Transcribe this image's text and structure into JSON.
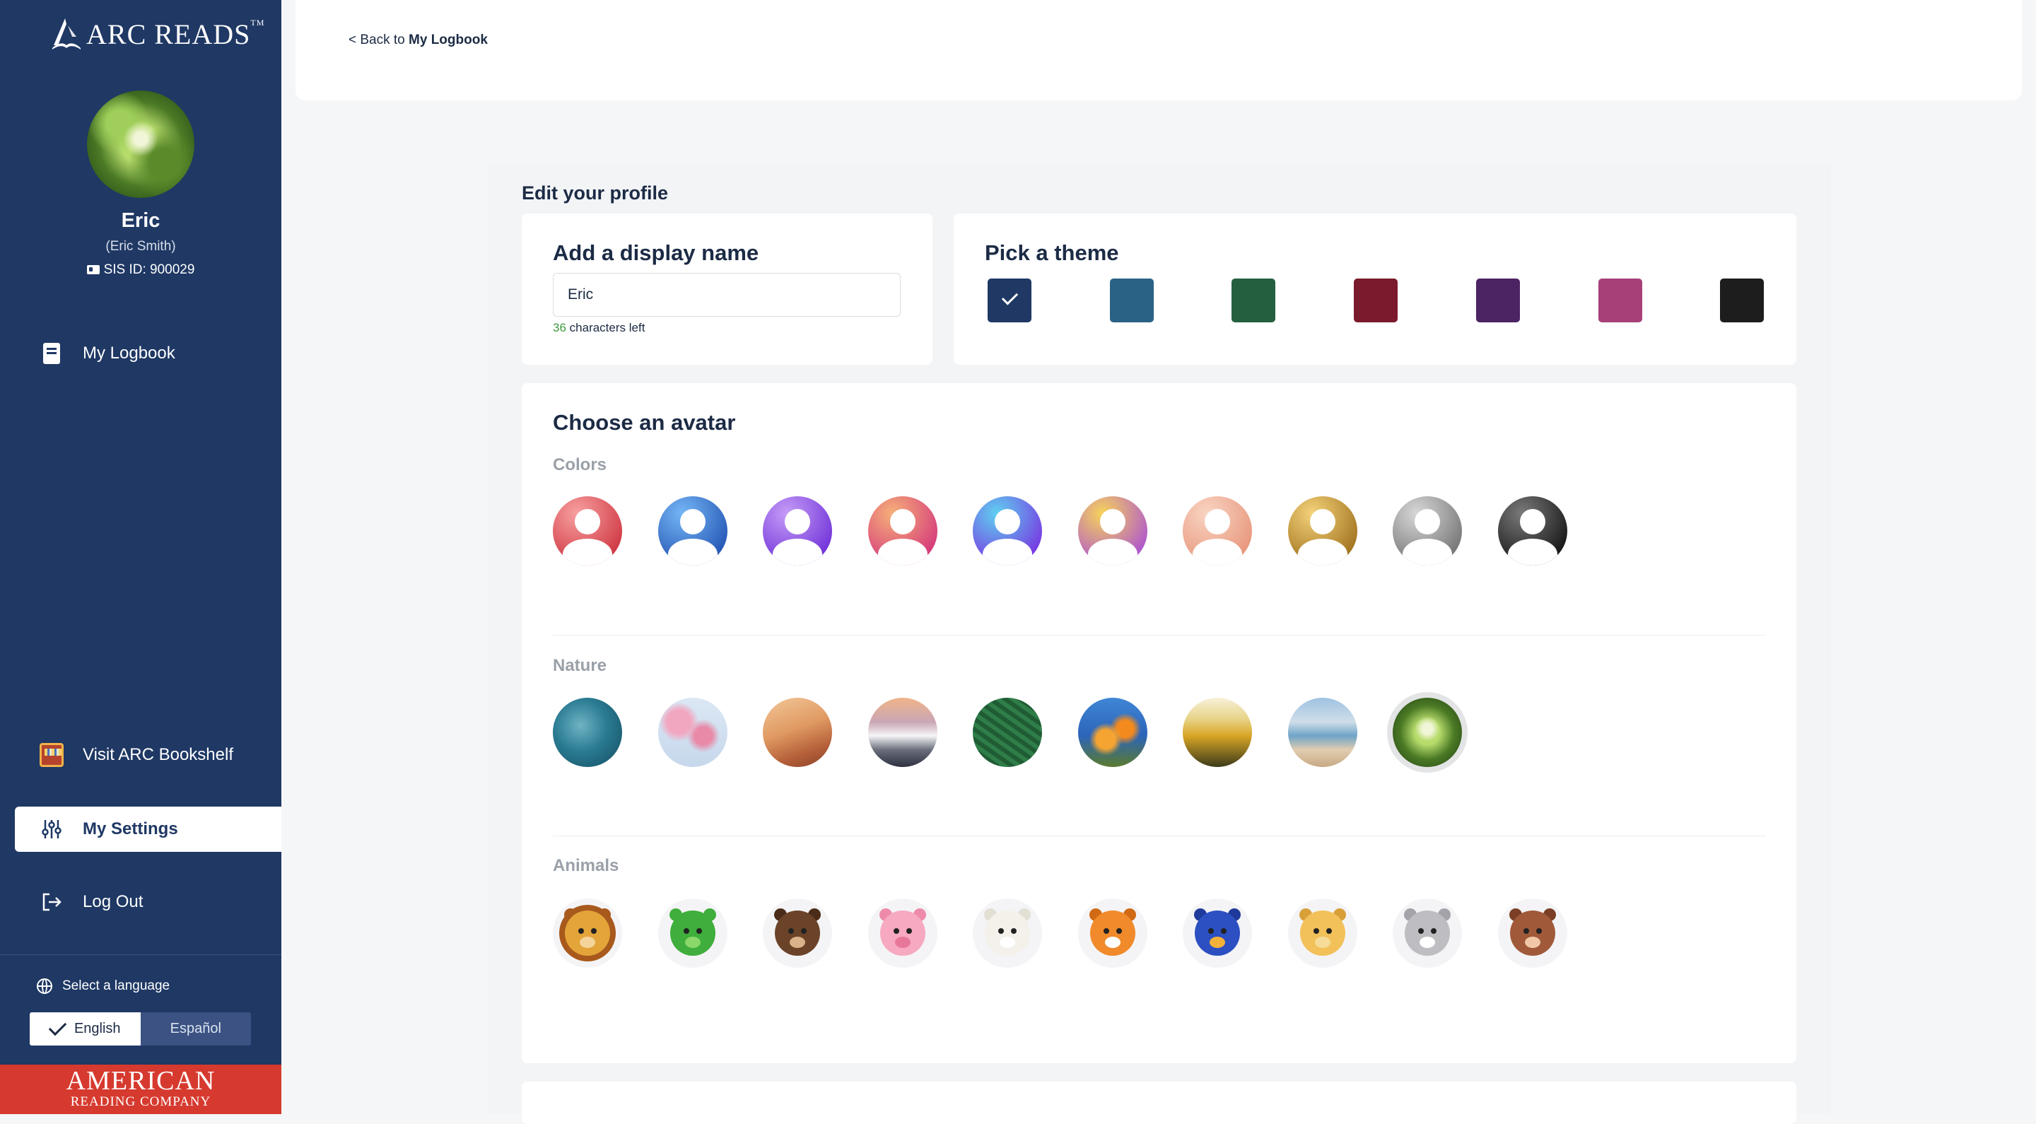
{
  "brand": {
    "name": "ARC READS",
    "trademark": "TM",
    "footer_line1": "AMERICAN",
    "footer_line2": "READING COMPANY"
  },
  "user": {
    "display_name": "Eric",
    "full_name": "(Eric Smith)",
    "sis": "SIS ID: 900029"
  },
  "nav": {
    "logbook": "My Logbook",
    "bookshelf": "Visit ARC Bookshelf",
    "settings": "My Settings",
    "logout": "Log Out"
  },
  "language": {
    "title": "Select a language",
    "options": [
      "English",
      "Español"
    ],
    "selected": "English"
  },
  "topbar": {
    "back_prefix": "< Back to ",
    "back_target": "My Logbook"
  },
  "page": {
    "title": "Edit your profile"
  },
  "display_name_card": {
    "title": "Add a display name",
    "value": "Eric",
    "chars_left_count": "36",
    "chars_left_text": "characters left"
  },
  "theme_card": {
    "title": "Pick a theme",
    "swatches": [
      "#1f3864",
      "#2a6285",
      "#24603f",
      "#7a1a2c",
      "#4c2463",
      "#a73f78",
      "#1d1d1d"
    ],
    "selected_index": 0
  },
  "avatar_card": {
    "title": "Choose an avatar",
    "colors_label": "Colors",
    "nature_label": "Nature",
    "animals_label": "Animals",
    "colors": [
      [
        "#f7a0a0",
        "#cc2f3b"
      ],
      [
        "#74b6f5",
        "#1f4fb0"
      ],
      [
        "#c59cf7",
        "#6a2bd6"
      ],
      [
        "#f6b07a",
        "#d2307b"
      ],
      [
        "#5fd0f0",
        "#7a2be0"
      ],
      [
        "#f7d35a",
        "#a84bd8"
      ],
      [
        "#f9d4c2",
        "#e69277"
      ],
      [
        "#f4d27a",
        "#9b6b17"
      ],
      [
        "#d8d8d8",
        "#6e6e6e"
      ],
      [
        "#7a7a7a",
        "#0e0e0e"
      ]
    ],
    "nature": [
      "ocean-water",
      "cherry-blossom",
      "desert-dunes",
      "mountain-sunset",
      "fern-leaves",
      "orange-flowers",
      "sunflower-field",
      "beach-shore",
      "forest-canopy"
    ],
    "nature_selected_index": 8,
    "animals": [
      "lion",
      "frog",
      "bear",
      "pig",
      "polar-bear",
      "tiger",
      "owl",
      "giraffe",
      "cat",
      "cow"
    ]
  }
}
